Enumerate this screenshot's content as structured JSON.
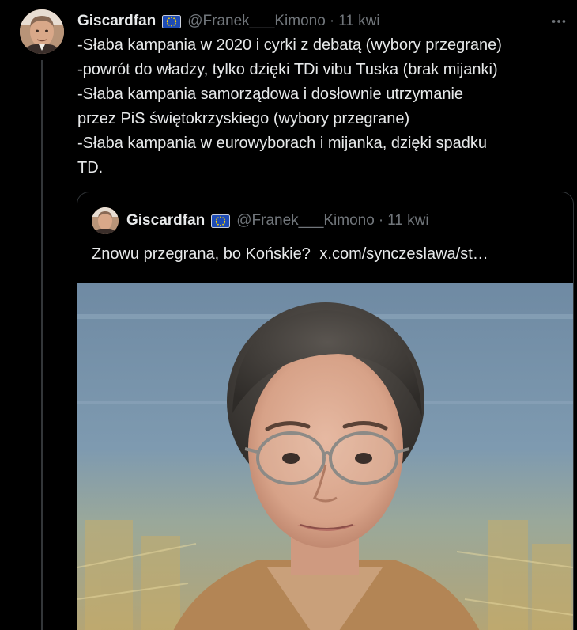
{
  "tweet": {
    "author_name": "Giscardfan",
    "handle": "@Franek___Kimono",
    "separator": "·",
    "time": "11 kwi",
    "more_icon": "more-dots-icon",
    "flag_icon": "eu-flag-icon",
    "body_lines": [
      "-Słaba kampania w 2020 i cyrki z debatą (wybory przegrane)",
      "-powrót do władzy, tylko dzięki TDi vibu Tuska  (brak mijanki)",
      "-Słaba kampania samorządowa i dosłownie utrzymanie",
      "przez PiS świętokrzyskiego (wybory przegrane)",
      "-Słaba kampania w eurowyborach i mijanka, dzięki spadku",
      "TD."
    ]
  },
  "quoted_tweet": {
    "author_name": "Giscardfan",
    "handle": "@Franek___Kimono",
    "separator": "·",
    "time": "11 kwi",
    "text": "Znowu przegrana, bo Końskie?",
    "link": "x.com/synczeslawa/st…",
    "media_icon": "photo-woman-glasses"
  },
  "colors": {
    "background": "#000000",
    "text_primary": "#e7e9ea",
    "text_secondary": "#71767b",
    "border": "#2f3336",
    "eu_blue": "#1d4bb5",
    "eu_yellow": "#ffd700"
  }
}
